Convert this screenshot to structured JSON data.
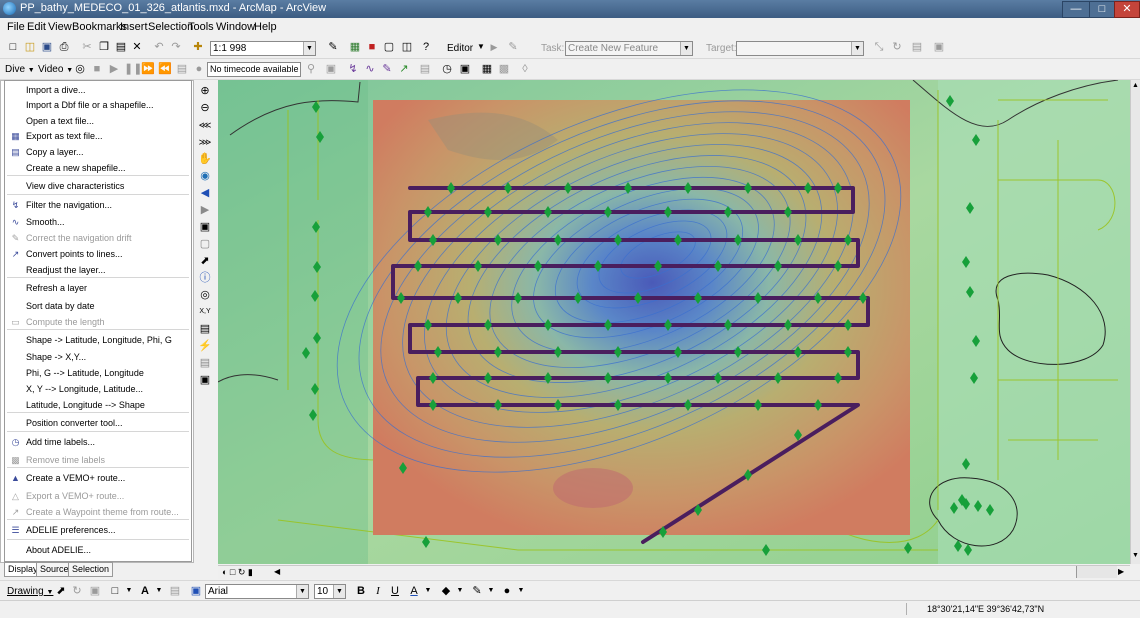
{
  "window": {
    "title": "PP_bathy_MEDECO_01_326_atlantis.mxd - ArcMap - ArcView",
    "min_label": "—",
    "max_label": "□",
    "close_label": "✕"
  },
  "menubar": [
    "File",
    "Edit",
    "View",
    "Bookmarks",
    "Insert",
    "Selection",
    "Tools",
    "Window",
    "Help"
  ],
  "standard_toolbar": {
    "scale_value": "1:1 998",
    "editor_label": "Editor",
    "task_label": "Task:",
    "task_value": "Create New Feature",
    "target_label": "Target:"
  },
  "dive_toolbar": {
    "dive_label": "Dive",
    "video_label": "Video",
    "timecode_value": "No timecode available"
  },
  "dive_menu": {
    "items": [
      {
        "label": "Import a dive...",
        "icon": "",
        "enabled": true
      },
      {
        "label": "Import a Dbf file or a shapefile...",
        "icon": "",
        "enabled": true
      },
      {
        "label": "Open a text file...",
        "icon": "",
        "enabled": true
      },
      {
        "label": "Export as text file...",
        "icon": "table-icon",
        "enabled": true
      },
      {
        "label": "Copy a layer...",
        "icon": "copy-layer-icon",
        "enabled": true
      },
      {
        "label": "Create a new shapefile...",
        "icon": "",
        "enabled": true
      },
      {
        "label": "View dive characteristics",
        "icon": "",
        "enabled": true
      },
      {
        "label": "Filter the navigation...",
        "icon": "filter-nav-icon",
        "enabled": true
      },
      {
        "label": "Smooth...",
        "icon": "smooth-icon",
        "enabled": true
      },
      {
        "label": "Correct the navigation drift",
        "icon": "drift-icon",
        "enabled": false
      },
      {
        "label": "Convert points to lines...",
        "icon": "points-to-lines-icon",
        "enabled": true
      },
      {
        "label": "Readjust the layer...",
        "icon": "",
        "enabled": true
      },
      {
        "label": "Refresh a layer",
        "icon": "",
        "enabled": true
      },
      {
        "label": "Sort data by date",
        "icon": "",
        "enabled": true
      },
      {
        "label": "Compute the length",
        "icon": "ruler-icon",
        "enabled": false
      },
      {
        "label": "Shape -> Latitude, Longitude, Phi, G",
        "icon": "",
        "enabled": true
      },
      {
        "label": "Shape -> X,Y...",
        "icon": "",
        "enabled": true
      },
      {
        "label": "Phi, G --> Latitude, Longitude",
        "icon": "",
        "enabled": true
      },
      {
        "label": "X, Y --> Longitude, Latitude...",
        "icon": "",
        "enabled": true
      },
      {
        "label": "Latitude, Longitude --> Shape",
        "icon": "",
        "enabled": true
      },
      {
        "label": "Position converter tool...",
        "icon": "",
        "enabled": true
      },
      {
        "label": "Add time labels...",
        "icon": "clock-icon",
        "enabled": true
      },
      {
        "label": "Remove time labels",
        "icon": "remove-labels-icon",
        "enabled": false
      },
      {
        "label": "Create a VEMO+ route...",
        "icon": "vemo-icon",
        "enabled": true
      },
      {
        "label": "Export a VEMO+ route...",
        "icon": "export-route-icon",
        "enabled": false
      },
      {
        "label": "Create a Waypoint theme from route...",
        "icon": "waypoint-icon",
        "enabled": false
      },
      {
        "label": "ADELIE preferences...",
        "icon": "preferences-icon",
        "enabled": true
      },
      {
        "label": "About ADELIE...",
        "icon": "",
        "enabled": true
      }
    ]
  },
  "toc_tabs": [
    "Display",
    "Source",
    "Selection"
  ],
  "drawing_toolbar": {
    "drawing_label": "Drawing",
    "font_value": "Arial",
    "size_value": "10",
    "bold": "B",
    "italic": "I",
    "underline": "U"
  },
  "status": {
    "coordinates": "18°30'21,14\"E  39°36'42,73\"N"
  },
  "map": {
    "track_color": "#4a1e5e",
    "marker_color": "#17a03a",
    "contour_color": "#3a6fd0",
    "isobath_color": "#9ac21a"
  }
}
